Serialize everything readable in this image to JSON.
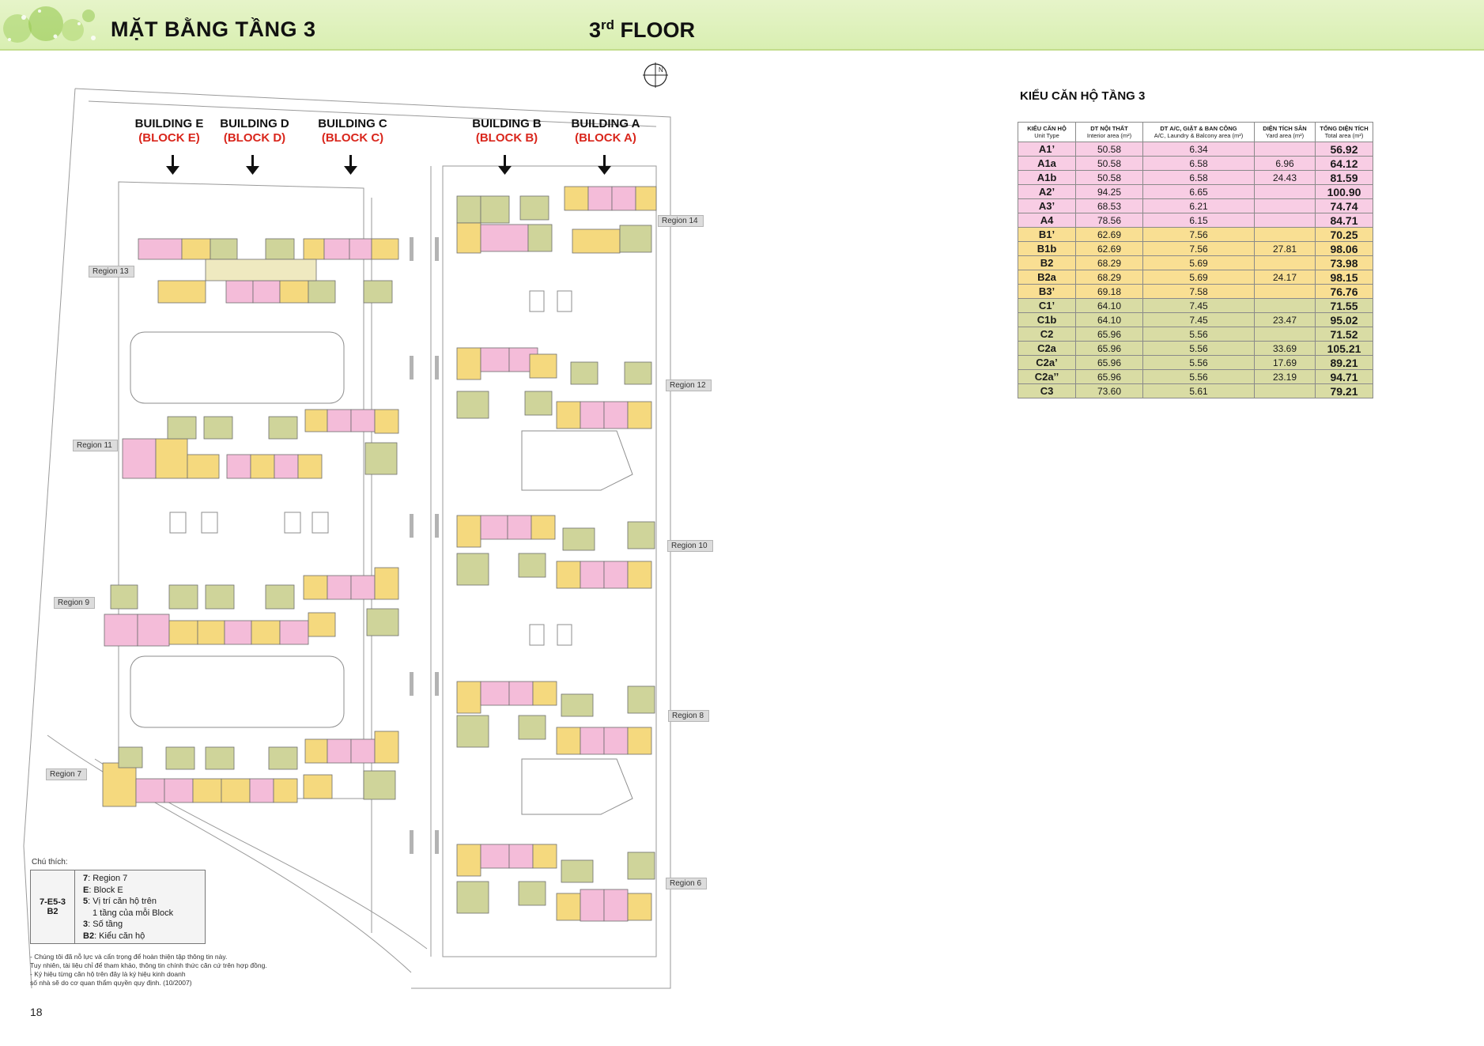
{
  "header": {
    "title_vn": "MẶT BẰNG TẦNG 3",
    "title_en_num": "3",
    "title_en_sup": "rd",
    "title_en_word": "FLOOR"
  },
  "compass": {
    "label": "N"
  },
  "buildings": [
    {
      "name": "BUILDING E",
      "block": "(BLOCK E)"
    },
    {
      "name": "BUILDING D",
      "block": "(BLOCK D)"
    },
    {
      "name": "BUILDING C",
      "block": "(BLOCK C)"
    },
    {
      "name": "BUILDING B",
      "block": "(BLOCK B)"
    },
    {
      "name": "BUILDING A",
      "block": "(BLOCK A)"
    }
  ],
  "regions": [
    "Region 14",
    "Region 13",
    "Region 12",
    "Region 11",
    "Region 10",
    "Region 9",
    "Region 8",
    "Region 7",
    "Region 6"
  ],
  "legend": {
    "title": "Chú thích:",
    "code_line1": "7-E5-3",
    "code_line2": "B2",
    "items": [
      {
        "key": "7",
        "text": ": Region 7"
      },
      {
        "key": "E",
        "text": ": Block E"
      },
      {
        "key": "5",
        "text": ": Vị trí căn hộ trên"
      },
      {
        "key": "",
        "text": "1 tầng của mỗi Block"
      },
      {
        "key": "3",
        "text": ": Số tầng"
      },
      {
        "key": "B2",
        "text": ": Kiểu căn hộ"
      }
    ]
  },
  "notes": [
    "- Chúng tôi đã nỗ lực và cẩn trọng để hoàn thiện tập thông tin này.",
    "  Tuy nhiên, tài liệu chỉ để tham khảo, thông tin chính thức căn cứ trên hợp đồng.",
    "- Ký hiệu từng căn hộ trên đây là ký hiệu kinh doanh",
    "  số nhà sẽ do cơ quan thẩm quyền quy định. (10/2007)"
  ],
  "page_number": "18",
  "unit_table": {
    "title": "KIỂU CĂN HỘ TẦNG 3",
    "headers": [
      {
        "main": "KIỂU CĂN HỘ",
        "sub": "Unit Type"
      },
      {
        "main": "DT NỘI THẤT",
        "sub": "Interior area (m²)"
      },
      {
        "main": "DT A/C, GIẶT & BAN CÔNG",
        "sub": "A/C, Laundry & Balcony area (m²)"
      },
      {
        "main": "DIỆN TÍCH SÂN",
        "sub": "Yard area (m²)"
      },
      {
        "main": "TỔNG DIỆN TÍCH",
        "sub": "Total area (m²)"
      }
    ],
    "rows": [
      {
        "type": "A1’",
        "interior": "50.58",
        "ac": "6.34",
        "yard": "",
        "total": "56.92",
        "group": "a"
      },
      {
        "type": "A1a",
        "interior": "50.58",
        "ac": "6.58",
        "yard": "6.96",
        "total": "64.12",
        "group": "a"
      },
      {
        "type": "A1b",
        "interior": "50.58",
        "ac": "6.58",
        "yard": "24.43",
        "total": "81.59",
        "group": "a"
      },
      {
        "type": "A2’",
        "interior": "94.25",
        "ac": "6.65",
        "yard": "",
        "total": "100.90",
        "group": "a"
      },
      {
        "type": "A3’",
        "interior": "68.53",
        "ac": "6.21",
        "yard": "",
        "total": "74.74",
        "group": "a"
      },
      {
        "type": "A4",
        "interior": "78.56",
        "ac": "6.15",
        "yard": "",
        "total": "84.71",
        "group": "a"
      },
      {
        "type": "B1’",
        "interior": "62.69",
        "ac": "7.56",
        "yard": "",
        "total": "70.25",
        "group": "b"
      },
      {
        "type": "B1b",
        "interior": "62.69",
        "ac": "7.56",
        "yard": "27.81",
        "total": "98.06",
        "group": "b"
      },
      {
        "type": "B2",
        "interior": "68.29",
        "ac": "5.69",
        "yard": "",
        "total": "73.98",
        "group": "b"
      },
      {
        "type": "B2a",
        "interior": "68.29",
        "ac": "5.69",
        "yard": "24.17",
        "total": "98.15",
        "group": "b"
      },
      {
        "type": "B3’",
        "interior": "69.18",
        "ac": "7.58",
        "yard": "",
        "total": "76.76",
        "group": "b"
      },
      {
        "type": "C1’",
        "interior": "64.10",
        "ac": "7.45",
        "yard": "",
        "total": "71.55",
        "group": "c"
      },
      {
        "type": "C1b",
        "interior": "64.10",
        "ac": "7.45",
        "yard": "23.47",
        "total": "95.02",
        "group": "c"
      },
      {
        "type": "C2",
        "interior": "65.96",
        "ac": "5.56",
        "yard": "",
        "total": "71.52",
        "group": "c"
      },
      {
        "type": "C2a",
        "interior": "65.96",
        "ac": "5.56",
        "yard": "33.69",
        "total": "105.21",
        "group": "c"
      },
      {
        "type": "C2a’",
        "interior": "65.96",
        "ac": "5.56",
        "yard": "17.69",
        "total": "89.21",
        "group": "c"
      },
      {
        "type": "C2a’’",
        "interior": "65.96",
        "ac": "5.56",
        "yard": "23.19",
        "total": "94.71",
        "group": "c"
      },
      {
        "type": "C3",
        "interior": "73.60",
        "ac": "5.61",
        "yard": "",
        "total": "79.21",
        "group": "c"
      }
    ]
  },
  "colors": {
    "header_bg": "#d9efb2",
    "block_label_red": "#d9261c",
    "unit_pink": "#f4bcd9",
    "unit_yellow": "#f5d97e",
    "unit_olive": "#cfd49a"
  }
}
